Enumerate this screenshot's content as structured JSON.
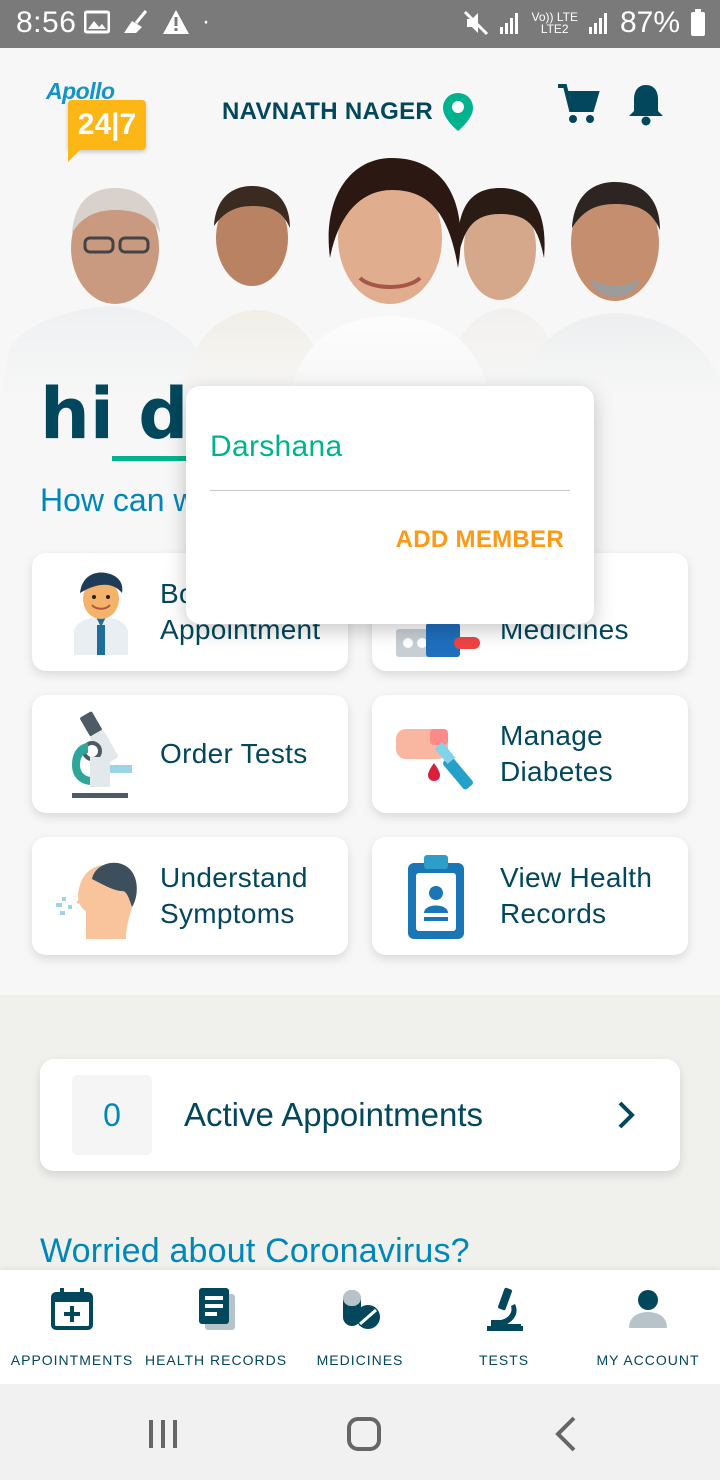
{
  "status_bar": {
    "time": "8:56",
    "battery": "87%",
    "network_top": "Vo)) LTE",
    "network_bottom": "LTE2"
  },
  "header": {
    "logo_text": "Apollo",
    "logo_badge": "24|7",
    "location": "NAVNATH NAGER"
  },
  "greeting": {
    "hi": "hi da",
    "subtitle": "How can w"
  },
  "popup": {
    "member_name": "Darshana",
    "add_member_label": "ADD MEMBER"
  },
  "cards": [
    {
      "label": "Book\nAppointment",
      "icon": "doctor-icon"
    },
    {
      "label": "Buy\nMedicines",
      "icon": "medicines-icon"
    },
    {
      "label": "Order Tests",
      "icon": "microscope-icon"
    },
    {
      "label": "Manage\nDiabetes",
      "icon": "blood-test-icon"
    },
    {
      "label": "Understand\nSymptoms",
      "icon": "symptoms-icon"
    },
    {
      "label": "View Health\nRecords",
      "icon": "health-records-icon"
    }
  ],
  "active_appointments": {
    "count": "0",
    "label": "Active Appointments"
  },
  "corona": {
    "title": "Worried about Coronavirus?"
  },
  "bottom_nav": [
    {
      "label": "APPOINTMENTS",
      "icon": "calendar-plus-icon"
    },
    {
      "label": "HEALTH RECORDS",
      "icon": "records-icon"
    },
    {
      "label": "MEDICINES",
      "icon": "pill-icon"
    },
    {
      "label": "TESTS",
      "icon": "microscope-icon"
    },
    {
      "label": "MY ACCOUNT",
      "icon": "account-icon"
    }
  ],
  "colors": {
    "primary_text": "#02475b",
    "accent_green": "#00b38e",
    "accent_blue": "#0087ba",
    "accent_orange": "#fc9916",
    "logo_yellow": "#fcb716"
  }
}
